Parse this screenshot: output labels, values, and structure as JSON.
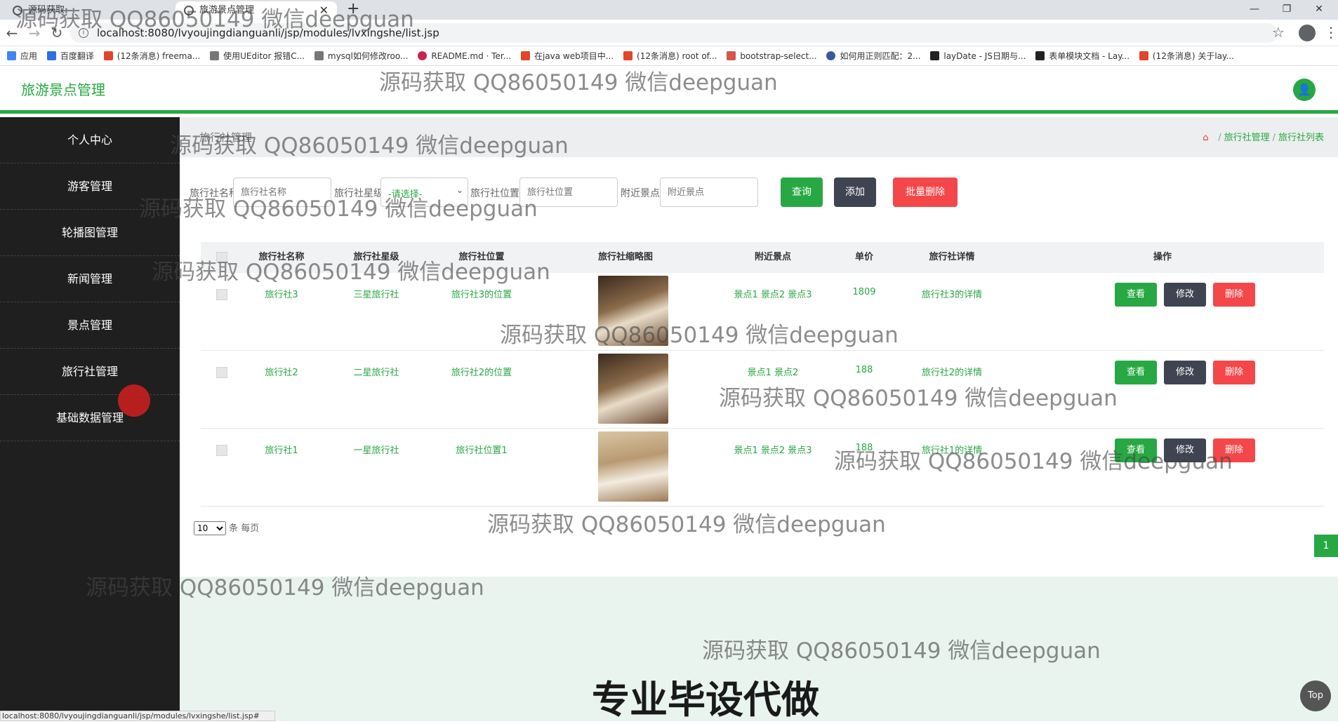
{
  "browser": {
    "tabs": [
      "源码获取",
      "旅游景点管理"
    ],
    "url": "localhost:8080/lvyoujingdianguanli/jsp/modules/lvxingshe/list.jsp",
    "bookmarks": [
      "应用",
      "百度翻译",
      "(12条消息) freema...",
      "使用UEditor 报错C...",
      "mysql如何修改roo...",
      "README.md · Ter...",
      "在java web项目中...",
      "(12条消息) root of...",
      "bootstrap-select...",
      "如何用正则匹配：2...",
      "layDate - JS日期与...",
      "表单模块文档 - Lay...",
      "(12条消息) 关于lay..."
    ],
    "status_url": "localhost:8080/lvyoujingdianguanli/jsp/modules/lvxingshe/list.jsp#"
  },
  "app": {
    "title": "旅游景点管理"
  },
  "sidebar": {
    "items": [
      {
        "label": "个人中心"
      },
      {
        "label": "游客管理"
      },
      {
        "label": "轮播图管理"
      },
      {
        "label": "新闻管理"
      },
      {
        "label": "景点管理"
      },
      {
        "label": "旅行社管理"
      },
      {
        "label": "基础数据管理"
      }
    ]
  },
  "page": {
    "title": "旅行社管理",
    "breadcrumb": [
      "旅行社管理",
      "旅行社列表"
    ]
  },
  "search": {
    "name_label": "旅行社名称",
    "name_placeholder": "旅行社名称",
    "level_label": "旅行社星级",
    "level_value": "-请选择-",
    "location_label": "旅行社位置",
    "location_placeholder": "旅行社位置",
    "spot_label": "附近景点",
    "spot_placeholder": "附近景点",
    "query_btn": "查询",
    "add_btn": "添加",
    "batch_delete_btn": "批量删除"
  },
  "table": {
    "headers": [
      "旅行社名称",
      "旅行社星级",
      "旅行社位置",
      "旅行社缩略图",
      "附近景点",
      "单价",
      "旅行社详情",
      "操作"
    ],
    "rows": [
      {
        "name": "旅行社3",
        "level": "三星旅行社",
        "location": "旅行社3的位置",
        "spots": "景点1 景点2 景点3",
        "price": "1809",
        "detail": "旅行社3的详情"
      },
      {
        "name": "旅行社2",
        "level": "二星旅行社",
        "location": "旅行社2的位置",
        "spots": "景点1 景点2",
        "price": "188",
        "detail": "旅行社2的详情"
      },
      {
        "name": "旅行社1",
        "level": "一星旅行社",
        "location": "旅行社位置1",
        "spots": "景点1 景点2 景点3",
        "price": "188",
        "detail": "旅行社1的详情"
      }
    ],
    "actions": {
      "view": "查看",
      "edit": "修改",
      "delete": "删除"
    }
  },
  "pager": {
    "page_size": "10",
    "page_size_suffix": "条 每页",
    "current_page": "1"
  },
  "watermarks": {
    "text": "源码获取 QQ86050149 微信deepguan",
    "big": "专业毕设代做"
  },
  "top_button": "Top",
  "colors": {
    "accent": "#27a843",
    "sidebar": "#1f1f1f",
    "danger": "#f4474a",
    "dark_button": "#3f4452"
  }
}
